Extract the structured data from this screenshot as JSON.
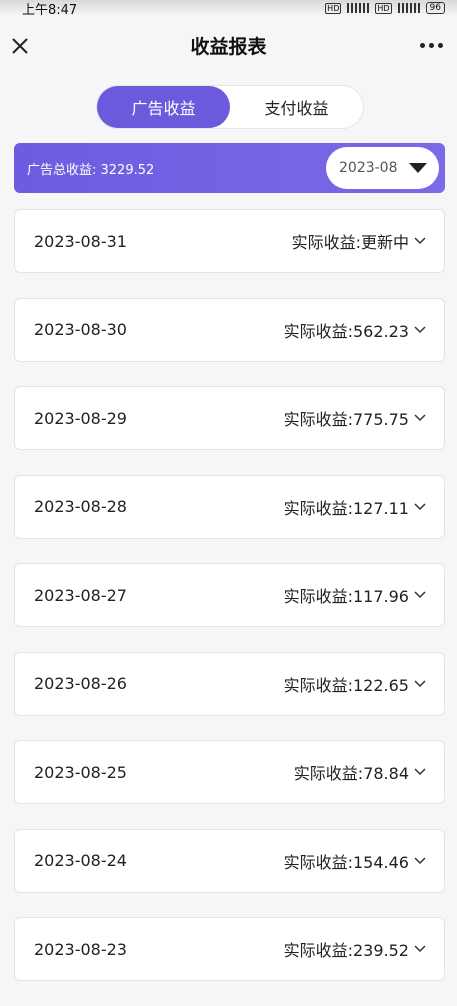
{
  "status_bar": {
    "time": "上午8:47",
    "battery": "96"
  },
  "nav": {
    "title": "收益报表"
  },
  "tabs": [
    {
      "label": "广告收益",
      "active": true
    },
    {
      "label": "支付收益",
      "active": false
    }
  ],
  "summary": {
    "label": "广告总收益: 3229.52",
    "month": "2023-08"
  },
  "rows": [
    {
      "date": "2023-08-31",
      "amount": "实际收益:更新中"
    },
    {
      "date": "2023-08-30",
      "amount": "实际收益:562.23"
    },
    {
      "date": "2023-08-29",
      "amount": "实际收益:775.75"
    },
    {
      "date": "2023-08-28",
      "amount": "实际收益:127.11"
    },
    {
      "date": "2023-08-27",
      "amount": "实际收益:117.96"
    },
    {
      "date": "2023-08-26",
      "amount": "实际收益:122.65"
    },
    {
      "date": "2023-08-25",
      "amount": "实际收益:78.84"
    },
    {
      "date": "2023-08-24",
      "amount": "实际收益:154.46"
    },
    {
      "date": "2023-08-23",
      "amount": "实际收益:239.52"
    }
  ],
  "colors": {
    "accent": "#6b5bdc",
    "background": "#f6f6f8"
  },
  "icons": {
    "close": "close-icon",
    "more": "more-icon",
    "dropdown": "triangle-down-icon",
    "expand": "chevron-down-icon"
  }
}
